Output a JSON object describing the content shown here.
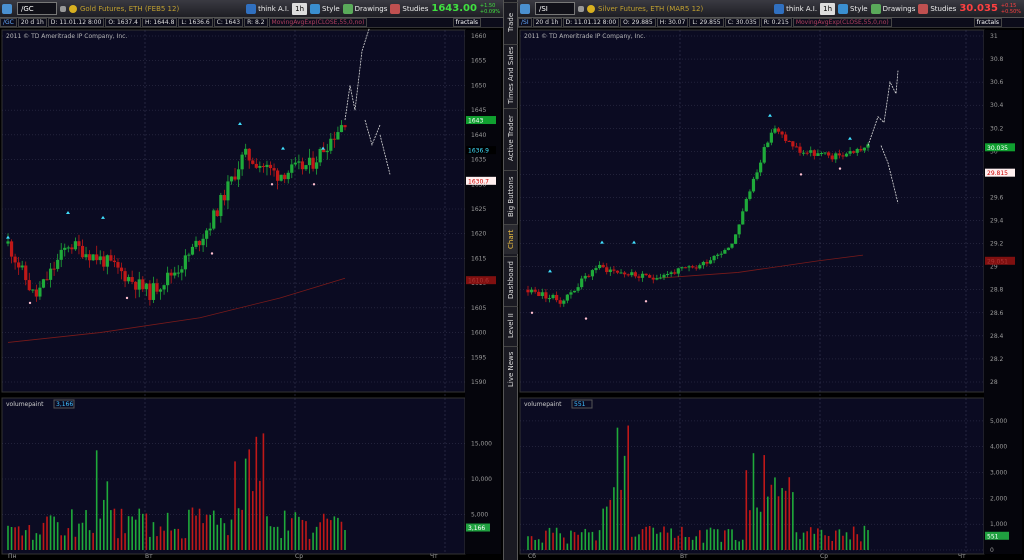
{
  "left": {
    "symbol": "/GC",
    "period": "20 d 1h",
    "description": "Gold Futures, ETH (FEB5 12)",
    "ai_label": "think A.I.",
    "interval": "1h",
    "style_label": "Style",
    "drawings_label": "Drawings",
    "studies_label": "Studies",
    "last_price": "1643.00",
    "change_top": "+1.50",
    "change_bottom": "+0.09%",
    "ohlc": {
      "d": "D: 11.01.12 8:00",
      "o": "O: 1637.4",
      "h": "H: 1644.8",
      "l": "L: 1636.6",
      "c": "C: 1643",
      "r": "R: 8.2"
    },
    "study": "MovingAvgExp(CLOSE,55,0,no)",
    "fractals": "fractals",
    "copyright": "2011 © TD Ameritrade IP Company, Inc.",
    "volume_label": "volumepaint",
    "volume_value": "3,166",
    "price_labels": {
      "last": "1643",
      "bid": "1636.9",
      "ask": "1630.7",
      "ma": "1610.6"
    },
    "y_ticks": [
      "1660",
      "1655",
      "1650",
      "1645",
      "1640",
      "1635",
      "1630",
      "1625",
      "1620",
      "1615",
      "1610",
      "1605",
      "1600",
      "1595",
      "1590"
    ],
    "vol_ticks": [
      "15,000",
      "10,000",
      "5,000"
    ],
    "x_ticks": [
      "Пн",
      "Вт",
      "Ср",
      "Чт"
    ]
  },
  "right": {
    "symbol": "/SI",
    "period": "20 d 1h",
    "description": "Silver Futures, ETH (MAR5 12)",
    "ai_label": "think A.I.",
    "interval": "1h",
    "style_label": "Style",
    "drawings_label": "Drawings",
    "studies_label": "Studies",
    "last_price": "30.035",
    "change_top": "+0.15",
    "change_bottom": "+0.50%",
    "ohlc": {
      "d": "D: 11.01.12 8:00",
      "o": "O: 29.885",
      "h": "H: 30.07",
      "l": "L: 29.855",
      "c": "C: 30.035",
      "r": "R: 0.215"
    },
    "study": "MovingAvgExp(CLOSE,55,0,no)",
    "fractals": "fractals",
    "copyright": "2011 © TD Ameritrade IP Company, Inc.",
    "volume_label": "volumepaint",
    "volume_value": "551",
    "price_labels": {
      "last": "30.035",
      "bid": "29.815",
      "ma": "29.051"
    },
    "y_ticks": [
      "31",
      "30.8",
      "30.6",
      "30.4",
      "30.2",
      "30",
      "29.8",
      "29.6",
      "29.4",
      "29.2",
      "29",
      "28.8",
      "28.6",
      "28.4",
      "28.2",
      "28"
    ],
    "vol_ticks": [
      "5,000",
      "4,000",
      "3,000",
      "2,000",
      "1,000",
      "0"
    ],
    "x_ticks": [
      "Сб",
      "Вт",
      "Ср",
      "Чт"
    ]
  },
  "sidebar": [
    "Trade",
    "Times And Sales",
    "Active Trader",
    "Big Buttons",
    "Chart",
    "Dashboard",
    "Level II",
    "Live News"
  ],
  "colors": {
    "up": "#1faa3a",
    "down": "#c01818",
    "bg": "#0b0b22",
    "grid": "#3a3a55",
    "axis_text": "#9a9a9a",
    "ma": "#7a1a1a",
    "accent": "#f0c040"
  }
}
